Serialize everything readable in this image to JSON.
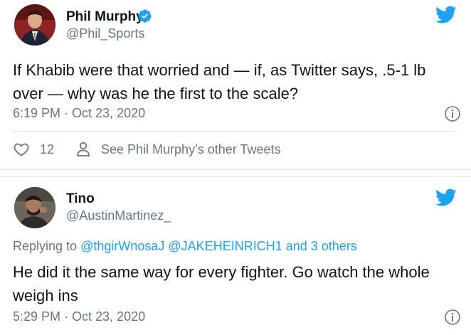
{
  "tweet1": {
    "author_name": "Phil Murphy",
    "author_handle": "@Phil_Sports",
    "text": "If Khabib were that worried and — if, as Twitter says, .5-1 lb over — why was he the first to the scale?",
    "timestamp": "6:19 PM · Oct 23, 2020",
    "like_count": "12",
    "other_tweets_label": "See Phil Murphy’s other Tweets",
    "icons": [
      "verified-badge-icon",
      "twitter-bird-icon",
      "info-icon",
      "heart-icon",
      "person-icon"
    ]
  },
  "tweet2": {
    "author_name": "Tino",
    "author_handle": "@AustinMartinez_",
    "replying_prefix": "Replying to",
    "mention1": "@thgirWnosaJ",
    "mention2": "@JAKEHEINRICH1",
    "replying_suffix": "and 3 others",
    "text": "He did it the same way for every fighter. Go watch the whole weigh ins",
    "timestamp": "5:29 PM · Oct 23, 2020",
    "icons": [
      "twitter-bird-icon",
      "info-icon"
    ]
  },
  "colors": {
    "twitter_blue": "#1da1f2",
    "secondary_text": "#657786",
    "primary_text": "#0f1419",
    "divider": "#e1e8ed"
  }
}
